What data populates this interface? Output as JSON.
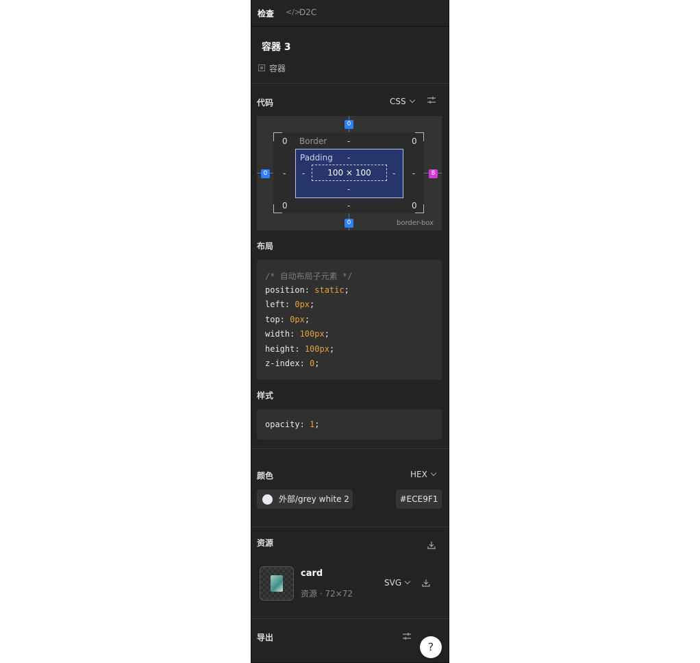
{
  "tabs": [
    {
      "label": "检查"
    },
    {
      "label": "D2C",
      "icon": "code-icon"
    }
  ],
  "layer": {
    "title": "容器 3",
    "type_label": "容器",
    "type_icon": "square-icon"
  },
  "code_section": {
    "title": "代码",
    "language": "CSS",
    "settings_icon": "sliders-icon"
  },
  "box_model": {
    "margin": {
      "top": "0",
      "right": "8",
      "bottom": "0",
      "left": "0"
    },
    "border_label": "Border",
    "border": {
      "top_left": "0",
      "top": "-",
      "top_right": "0",
      "left": "-",
      "right": "-",
      "bottom_left": "0",
      "bottom": "-",
      "bottom_right": "0"
    },
    "padding_label": "Padding",
    "padding": {
      "top": "-",
      "left": "-",
      "right": "-",
      "bottom": "-"
    },
    "content_size": "100 × 100",
    "box_sizing": "border-box"
  },
  "layout_section": {
    "title": "布局",
    "comment": "/* 自动布局子元素 */",
    "props": [
      {
        "name": "position",
        "value": "static"
      },
      {
        "name": "left",
        "value": "0px"
      },
      {
        "name": "top",
        "value": "0px"
      },
      {
        "name": "width",
        "value": "100px"
      },
      {
        "name": "height",
        "value": "100px"
      },
      {
        "name": "z-index",
        "value": "0"
      }
    ]
  },
  "style_section": {
    "title": "样式",
    "props": [
      {
        "name": "opacity",
        "value": "1"
      }
    ]
  },
  "color_section": {
    "title": "颜色",
    "format": "HEX",
    "swatch_color": "#ECE9F1",
    "color_name": "外部/grey white 2",
    "color_value": "#ECE9F1"
  },
  "assets_section": {
    "title": "资源",
    "download_icon": "download-icon",
    "asset": {
      "name": "card",
      "meta": "资源 · 72×72",
      "format": "SVG"
    }
  },
  "export_section": {
    "title": "导出"
  },
  "help": {
    "label": "?"
  }
}
